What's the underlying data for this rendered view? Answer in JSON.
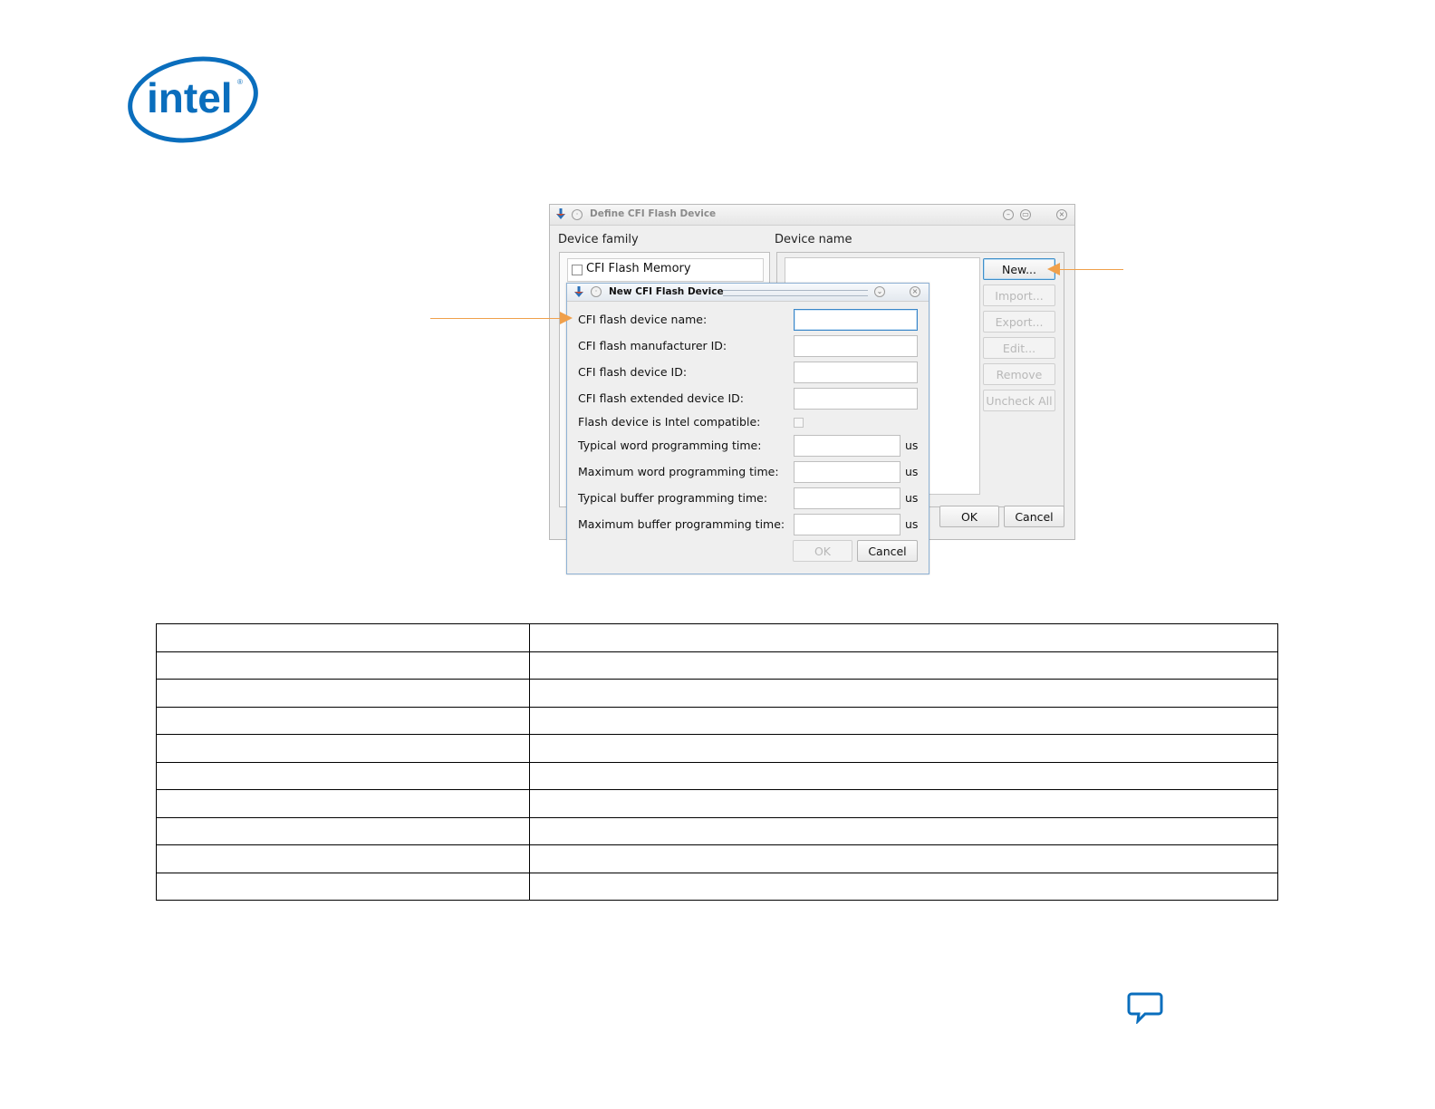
{
  "brand": {
    "logo_text": "intel",
    "color": "#0a6ebd"
  },
  "outer_dialog": {
    "title": "Define CFI Flash Device",
    "device_family_label": "Device family",
    "device_name_label": "Device name",
    "family_items": [
      {
        "label": "CFI Flash Memory",
        "checked": false
      }
    ],
    "buttons": {
      "new": "New...",
      "import": "Import...",
      "export": "Export...",
      "edit": "Edit...",
      "remove": "Remove",
      "uncheck_all": "Uncheck All",
      "ok": "OK",
      "cancel": "Cancel"
    }
  },
  "inner_dialog": {
    "title": "New CFI Flash Device",
    "fields": {
      "device_name": {
        "label": "CFI flash device name:",
        "value": ""
      },
      "manufacturer_id": {
        "label": "CFI flash manufacturer ID:",
        "value": ""
      },
      "device_id": {
        "label": "CFI flash device ID:",
        "value": ""
      },
      "extended_device_id": {
        "label": "CFI flash extended device ID:",
        "value": ""
      },
      "intel_compatible": {
        "label": "Flash device is Intel compatible:",
        "checked": false
      },
      "typ_word_time": {
        "label": "Typical word programming time:",
        "value": "",
        "unit": "us"
      },
      "max_word_time": {
        "label": "Maximum word programming time:",
        "value": "",
        "unit": "us"
      },
      "typ_buffer_time": {
        "label": "Typical buffer programming time:",
        "value": "",
        "unit": "us"
      },
      "max_buffer_time": {
        "label": "Maximum buffer programming time:",
        "value": "",
        "unit": "us"
      }
    },
    "buttons": {
      "ok": "OK",
      "cancel": "Cancel"
    }
  },
  "annotation_color": "#f0a04b",
  "table": {
    "rows": [
      [
        "",
        ""
      ],
      [
        "",
        ""
      ],
      [
        "",
        ""
      ],
      [
        "",
        ""
      ],
      [
        "",
        ""
      ],
      [
        "",
        ""
      ],
      [
        "",
        ""
      ],
      [
        "",
        ""
      ],
      [
        "",
        ""
      ],
      [
        "",
        ""
      ]
    ]
  },
  "feedback_icon": "chat-bubble-icon"
}
